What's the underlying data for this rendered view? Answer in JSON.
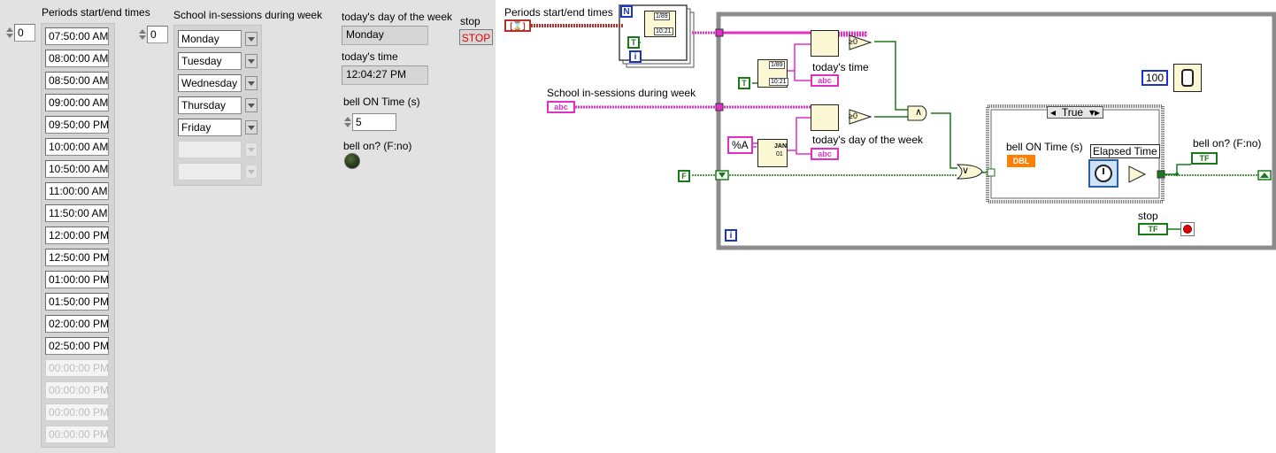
{
  "front_panel": {
    "periods": {
      "label": "Periods start/end times",
      "index": "0",
      "items": [
        "07:50:00 AM",
        "08:00:00 AM",
        "08:50:00 AM",
        "09:00:00 AM",
        "09:50:00 PM",
        "10:00:00 AM",
        "10:50:00 AM",
        "11:00:00 AM",
        "11:50:00 AM",
        "12:00:00 PM",
        "12:50:00 PM",
        "01:00:00 PM",
        "01:50:00 PM",
        "02:00:00 PM",
        "02:50:00 PM"
      ],
      "empty_items": [
        "00:00:00 PM",
        "00:00:00 PM",
        "00:00:00 PM",
        "00:00:00 PM"
      ]
    },
    "sessions": {
      "label": "School in-sessions during week",
      "index": "0",
      "items": [
        "Monday",
        "Tuesday",
        "Wednesday",
        "Thursday",
        "Friday"
      ],
      "empty_count": 2
    },
    "day_of_week": {
      "label": "today's day of the week",
      "value": "Monday"
    },
    "time": {
      "label": "today's time",
      "value": "12:04:27 PM"
    },
    "bell_on_time": {
      "label": "bell ON Time (s)",
      "value": "5"
    },
    "bell_on": {
      "label": "bell on? (F:no)"
    },
    "stop": {
      "label": "stop",
      "button": "STOP"
    }
  },
  "block_diagram": {
    "periods_label": "Periods start/end times",
    "periods_term": "[⌛]",
    "for_n": "N",
    "for_i": "i",
    "true_const": "T",
    "sessions_label": "School in-sessions during week",
    "abc": "abc",
    "todays_time_label": "today's time",
    "todays_day_label": "today's day of the week",
    "fmt_const": "%A",
    "false_const": "F",
    "while_i": "i",
    "case_selector": "True",
    "bell_on_time_label": "bell ON Time (s)",
    "dbl": "DBL",
    "elapsed_label": "Elapsed Time",
    "bell_on_label": "bell on? (F:no)",
    "tf": "TF",
    "stop_label": "stop",
    "wait_const": "100",
    "gte0": "≥0",
    "date_tag": "1/89",
    "time_tag": "10:21",
    "jan": "JAN",
    "day01": "01",
    "and_sym": "∧",
    "or_sym": "∨"
  },
  "colors": {
    "string_wire": "#e030c8",
    "bool_wire": "#1a7a1a",
    "timestamp_wire": "#b8302c",
    "dbl_wire": "#ff7f00",
    "loop_border": "#8c8c8c",
    "front_panel_bg": "#e2e2e2"
  }
}
